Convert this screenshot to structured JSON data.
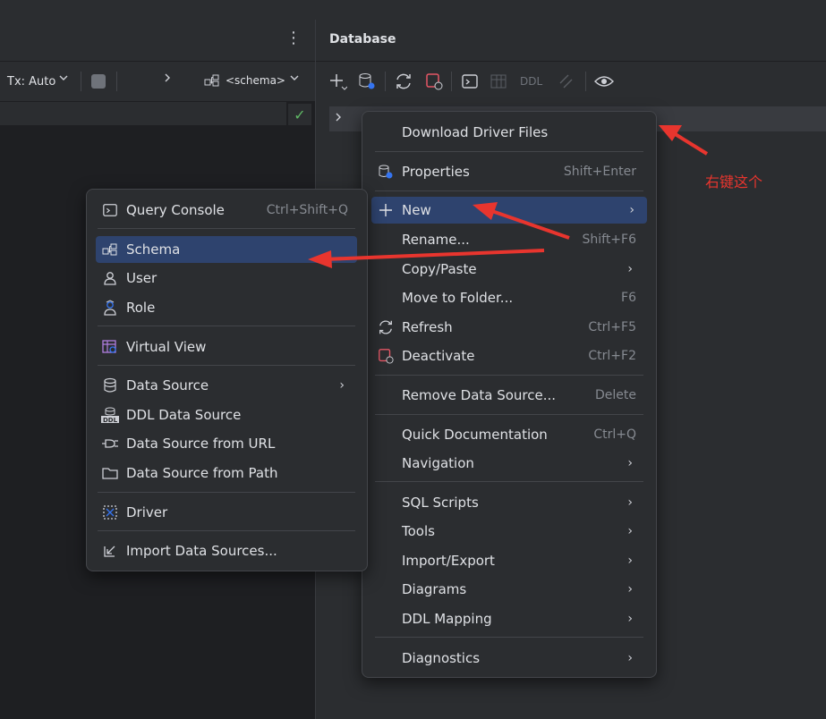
{
  "editor": {
    "tx_label": "Tx: Auto",
    "schema_label": "<schema>"
  },
  "database_panel": {
    "title": "Database",
    "ddl_label": "DDL"
  },
  "context_menu": {
    "items": [
      {
        "label": "Download Driver Files",
        "shortcut": ""
      },
      {
        "label": "Properties",
        "shortcut": "Shift+Enter"
      },
      {
        "label": "New",
        "shortcut": ""
      },
      {
        "label": "Rename...",
        "shortcut": "Shift+F6"
      },
      {
        "label": "Copy/Paste",
        "shortcut": ""
      },
      {
        "label": "Move to Folder...",
        "shortcut": "F6"
      },
      {
        "label": "Refresh",
        "shortcut": "Ctrl+F5"
      },
      {
        "label": "Deactivate",
        "shortcut": "Ctrl+F2"
      },
      {
        "label": "Remove Data Source...",
        "shortcut": "Delete"
      },
      {
        "label": "Quick Documentation",
        "shortcut": "Ctrl+Q"
      },
      {
        "label": "Navigation",
        "shortcut": ""
      },
      {
        "label": "SQL Scripts",
        "shortcut": ""
      },
      {
        "label": "Tools",
        "shortcut": ""
      },
      {
        "label": "Import/Export",
        "shortcut": ""
      },
      {
        "label": "Diagrams",
        "shortcut": ""
      },
      {
        "label": "DDL Mapping",
        "shortcut": ""
      },
      {
        "label": "Diagnostics",
        "shortcut": ""
      }
    ]
  },
  "new_submenu": {
    "items": [
      {
        "label": "Query Console",
        "shortcut": "Ctrl+Shift+Q"
      },
      {
        "label": "Schema",
        "shortcut": ""
      },
      {
        "label": "User",
        "shortcut": ""
      },
      {
        "label": "Role",
        "shortcut": ""
      },
      {
        "label": "Virtual View",
        "shortcut": ""
      },
      {
        "label": "Data Source",
        "shortcut": ""
      },
      {
        "label": "DDL Data Source",
        "shortcut": ""
      },
      {
        "label": "Data Source from URL",
        "shortcut": ""
      },
      {
        "label": "Data Source from Path",
        "shortcut": ""
      },
      {
        "label": "Driver",
        "shortcut": ""
      },
      {
        "label": "Import Data Sources...",
        "shortcut": ""
      }
    ]
  },
  "annotation": {
    "text": "右键这个"
  },
  "colors": {
    "selection": "#2e436e",
    "annotation": "#e8352e",
    "menu_bg": "#2b2d30"
  }
}
